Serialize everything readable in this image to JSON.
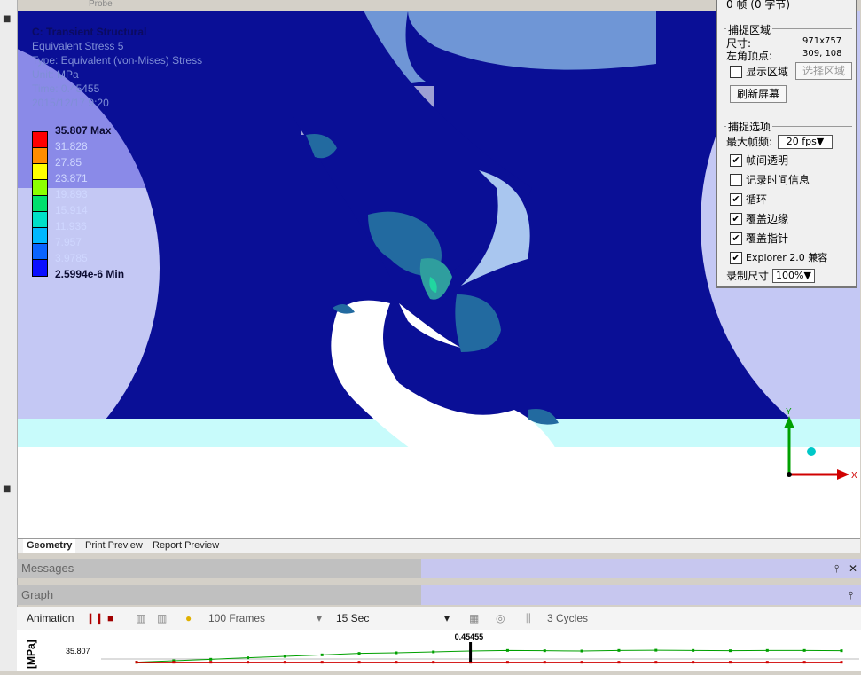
{
  "window": {
    "top_tab_label": "Probe"
  },
  "legend": {
    "title": "C: Transient Structural",
    "line2": "Equivalent Stress 5",
    "line3": "Type: Equivalent (von-Mises) Stress",
    "line4": "Unit: MPa",
    "line5": "Time: 0.45455",
    "line6": "2015/12/17 9:20",
    "max_label": "35.807 Max",
    "min_label": "2.5994e-6 Min",
    "values": [
      "31.828",
      "27.85",
      "23.871",
      "19.893",
      "15.914",
      "11.936",
      "7.957",
      "3.9785"
    ],
    "colors": [
      "#ff0000",
      "#ff8c00",
      "#ffff00",
      "#8cff00",
      "#00e06e",
      "#00e0c8",
      "#00b8ff",
      "#0a64ff",
      "#0a0fff"
    ]
  },
  "view_tabs": [
    "Geometry",
    "Print Preview",
    "Report Preview"
  ],
  "panels": {
    "messages": "Messages",
    "graph": "Graph"
  },
  "animation": {
    "label": "Animation",
    "frames": "100 Frames",
    "duration": "15 Sec",
    "cycles": "3 Cycles"
  },
  "chart_data": {
    "type": "line",
    "ylabel": "[MPa]",
    "y_tick": "35.807",
    "marker_label": "0.45455",
    "series": [
      {
        "values": [
          35.4,
          35.45,
          35.5,
          35.55,
          35.6,
          35.65,
          35.7,
          35.72,
          35.75,
          35.78,
          35.8,
          35.79,
          35.78,
          35.8,
          35.807,
          35.8,
          35.79,
          35.8,
          35.8,
          35.79
        ]
      },
      {
        "values": [
          35.4,
          35.4,
          35.4,
          35.4,
          35.4,
          35.4,
          35.4,
          35.4,
          35.4,
          35.4,
          35.4,
          35.4,
          35.4,
          35.4,
          35.4,
          35.4,
          35.4,
          35.4,
          35.4,
          35.4
        ]
      }
    ],
    "colors": [
      "#00a000",
      "#d00000"
    ],
    "marker_index": 9
  },
  "capture": {
    "header": "0 帧 (0 字节)",
    "section1": "捕捉区域",
    "size_label": "尺寸:",
    "size_value": "971x757",
    "corner_label": "左角顶点:",
    "corner_value": "309, 108",
    "show_region": "显示区域",
    "select_region": "选择区域",
    "refresh": "刷新屏幕",
    "section2": "捕捉选项",
    "max_fps_label": "最大帧频:",
    "max_fps_value": "20 fps▼",
    "options": [
      {
        "label": "帧间透明",
        "checked": true
      },
      {
        "label": "记录时间信息",
        "checked": false
      },
      {
        "label": "循环",
        "checked": true
      },
      {
        "label": "覆盖边缘",
        "checked": true
      },
      {
        "label": "覆盖指针",
        "checked": true
      },
      {
        "label": "Explorer 2.0 兼容",
        "checked": true
      }
    ],
    "record_size_label": "录制尺寸",
    "record_size_value": "100%▼"
  },
  "axes_triad": {
    "x": "X",
    "y": "Y"
  }
}
